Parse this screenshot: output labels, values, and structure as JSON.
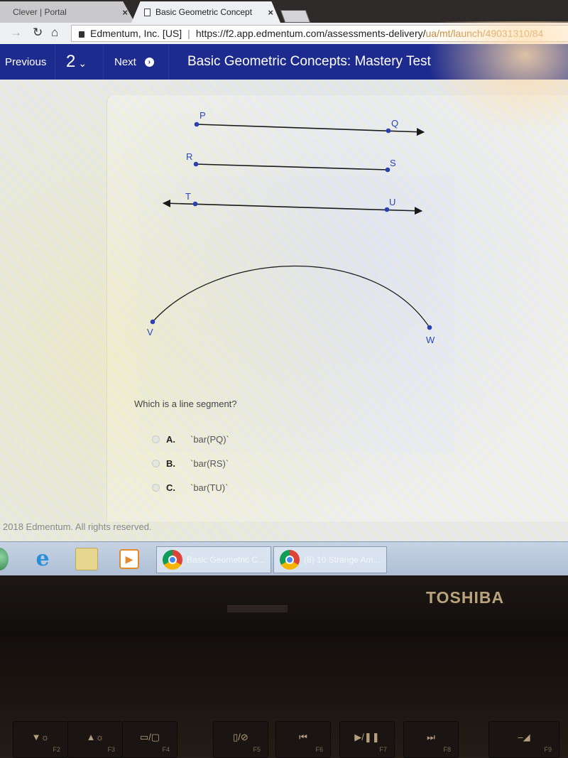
{
  "browser": {
    "tabs": [
      {
        "label": "Clever | Portal",
        "active": false
      },
      {
        "label": "Basic Geometric Concept",
        "active": true
      }
    ],
    "tab_close_glyph": "×",
    "address_bar": {
      "site_identity": "Edmentum, Inc. [US]",
      "url_main": "https://f2.app.edmentum.com/assessments-delivery/",
      "url_rest": "ua/mt/launch/49031310/84"
    }
  },
  "appbar": {
    "previous_label": "Previous",
    "question_number": "2",
    "next_label": "Next",
    "title": "Basic Geometric Concepts: Mastery Test"
  },
  "figure": {
    "colors": {
      "point": "#2b3fb0",
      "line": "#1a1a1a",
      "label": "#2b45b8"
    },
    "items": [
      {
        "type": "ray",
        "points": [
          "P",
          "Q"
        ]
      },
      {
        "type": "segment",
        "points": [
          "R",
          "S"
        ]
      },
      {
        "type": "line",
        "points": [
          "T",
          "U"
        ]
      },
      {
        "type": "arc",
        "points": [
          "V",
          "W"
        ]
      }
    ]
  },
  "question": {
    "prompt": "Which is a line segment?",
    "choices": [
      {
        "letter": "A.",
        "text": "`bar(PQ)`",
        "selected": false
      },
      {
        "letter": "B.",
        "text": "`bar(RS)`",
        "selected": false
      },
      {
        "letter": "C.",
        "text": "`bar(TU)`",
        "selected": false
      }
    ]
  },
  "footer": {
    "copyright": "2018 Edmentum. All rights reserved."
  },
  "taskbar": {
    "windows": [
      {
        "label": "Basic Geometric C..."
      },
      {
        "label": "(8) 10 Strange Am..."
      }
    ]
  },
  "laptop": {
    "brand": "TOSHIBA",
    "function_keys": [
      {
        "glyph": "▼☼",
        "label": "F2"
      },
      {
        "glyph": "▲☼",
        "label": "F3"
      },
      {
        "glyph": "▭/▢",
        "label": "F4"
      },
      {
        "glyph": "▯/⊘",
        "label": "F5"
      },
      {
        "glyph": "⏮",
        "label": "F6"
      },
      {
        "glyph": "▶/❚❚",
        "label": "F7"
      },
      {
        "glyph": "⏭",
        "label": "F8"
      },
      {
        "glyph": "‒◢",
        "label": "F9"
      }
    ]
  }
}
